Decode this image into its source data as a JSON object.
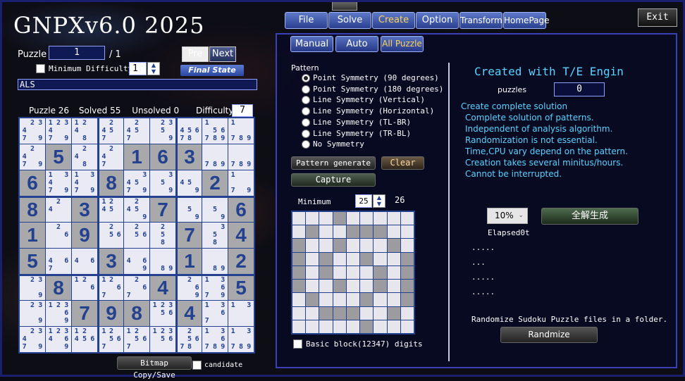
{
  "app_title": "GNPXv6.0 2025",
  "top_handle": "",
  "menu": {
    "file": "File",
    "solve": "Solve",
    "create": "Create",
    "option": "Option",
    "transform": "Transform",
    "homepage": "HomePage"
  },
  "exit_label": "Exit",
  "submenu": {
    "manual": "Manual",
    "auto": "Auto",
    "all_puzzle": "All Puzzle"
  },
  "puzzle_label": "Puzzle",
  "puzzle_value": "1",
  "puzzle_total": "/ 1",
  "pre_label": "Pre",
  "next_label": "Next",
  "min_difficulty_label": "Minimum Difficulty",
  "min_difficulty_value": "1",
  "final_state_label": "Final State",
  "method_text": "ALS",
  "stats": {
    "puzzle_label": "Puzzle",
    "puzzle_value": "26",
    "solved_label": "Solved",
    "solved_value": "55",
    "unsolved_label": "Unsolved",
    "unsolved_value": "0",
    "difficulty_label": "Difficulty",
    "difficulty_value": "7"
  },
  "grid": [
    [
      "c:2,3,4,7,9",
      "c:1,2,3,4,7,9",
      "c:1,2,4,8",
      "c:2,4,5,7",
      "c:2,4,5,7",
      "c:2,3,5,9",
      "c:4,5,6,7,8",
      "c:1,5,6,7,8,9",
      "c:1,7,8,9"
    ],
    [
      "c:2,4,7,9",
      "g:5",
      "c:2,4,8",
      "c:2,4,7",
      "g:1",
      "g:6",
      "g:3",
      "c:7,8,9",
      "c:7,8,9"
    ],
    [
      "g:6",
      "c:1,3,4,7,9",
      "c:1,3,4,7,9",
      "g:8",
      "c:3,4,5,7,9",
      "c:3,5,9",
      "c:4,5,9",
      "g:2",
      "c:1,7,9"
    ],
    [
      "g:8",
      "c:2,4",
      "g:3",
      "c:1,2,4,5",
      "c:2,4,5,9",
      "g:7",
      "c:5,9",
      "c:5,9",
      "g:6"
    ],
    [
      "g:1",
      "c:2,6",
      "g:9",
      "c:2,5,6",
      "c:2,5,6",
      "c:2,5,8",
      "g:7",
      "c:3,5,8",
      "g:4"
    ],
    [
      "g:5",
      "c:4,6,7",
      "c:4,6",
      "g:3",
      "c:4,6,9",
      "c:8,9",
      "g:1",
      "c:8,9",
      "g:2"
    ],
    [
      "c:2,3,9",
      "g:8",
      "c:1,2,6",
      "c:1,2,6,7",
      "c:2,6,7",
      "g:4",
      "c:2,6,9",
      "c:1,3,6,7,9",
      "g:5"
    ],
    [
      "c:2,3,9",
      "c:1,2,3,6,9",
      "g:7",
      "g:9",
      "g:8",
      "c:1,2,3,5,6",
      "g:4",
      "c:1,3,6,7",
      "c:1,3"
    ],
    [
      "c:2,3,4,7,9",
      "c:1,2,3,4,6,9",
      "c:1,2,4,5,6",
      "c:1,2,5,6,7",
      "c:1,2,5,6,7",
      "c:1,2,3,5,6",
      "c:2,5,6,7,8",
      "c:1,3,6,7,8,9",
      "c:1,3,7,8,9"
    ]
  ],
  "bitmap_button": "Bitmap Copy/Save",
  "candidate_label": "candidate",
  "pattern": {
    "title": "Pattern",
    "options": [
      "Point Symmetry (90 degrees)",
      "Point Symmetry (180 degrees)",
      "Line Symmetry (Vertical)",
      "Line Symmetry (Horizontal)",
      "Line Symmetry (TL-BR)",
      "Line Symmetry (TR-BL)",
      "No Symmetry"
    ],
    "selected": 0,
    "generate_label": "Pattern generate",
    "clear_label": "Clear",
    "capture_label": "Capture",
    "minimum_label": "Minimum",
    "minimum_value": "25",
    "count_value": "26",
    "cells": [
      [
        0,
        0,
        0,
        1,
        0,
        0,
        0,
        0,
        0
      ],
      [
        0,
        1,
        0,
        0,
        1,
        1,
        1,
        0,
        0
      ],
      [
        1,
        0,
        0,
        1,
        0,
        0,
        0,
        1,
        0
      ],
      [
        1,
        0,
        1,
        0,
        0,
        1,
        0,
        0,
        1
      ],
      [
        1,
        0,
        1,
        0,
        0,
        0,
        1,
        0,
        1
      ],
      [
        1,
        0,
        0,
        1,
        0,
        0,
        1,
        0,
        1
      ],
      [
        0,
        1,
        0,
        0,
        0,
        1,
        0,
        0,
        1
      ],
      [
        0,
        0,
        1,
        1,
        1,
        0,
        0,
        1,
        0
      ],
      [
        0,
        0,
        0,
        0,
        0,
        1,
        0,
        0,
        0
      ]
    ],
    "basic_block_label": "Basic block(12347) digits"
  },
  "create": {
    "heading": "Created with T/E Engin",
    "puzzles_label": "puzzles",
    "puzzles_value": "0",
    "info_lines": [
      "Create complete solution",
      "Complete solution of patterns.",
      "Independent of analysis algorithm.",
      "Randomization is not essential.",
      "Time,CPU vary depend on the pattern.",
      "Creation takes several minitus/hours.",
      "Cannot be interrupted."
    ],
    "percent_value": "10%",
    "generate_all_label": "全解生成",
    "elapsed_label": "Elapsed",
    "elapsed_value": "0t",
    "dots": [
      ".....",
      "...",
      ".....",
      "....."
    ],
    "randomize_text": "Randomize Sudoku Puzzle files in a folder.",
    "randomize_button": "Randmize"
  },
  "colors": {
    "accent": "#23418f",
    "given_cell": "#a9a9ab",
    "cell_bg": "#e9eaf3",
    "info_text": "#5ad3ff",
    "panel_border": "#3b3fb8"
  }
}
